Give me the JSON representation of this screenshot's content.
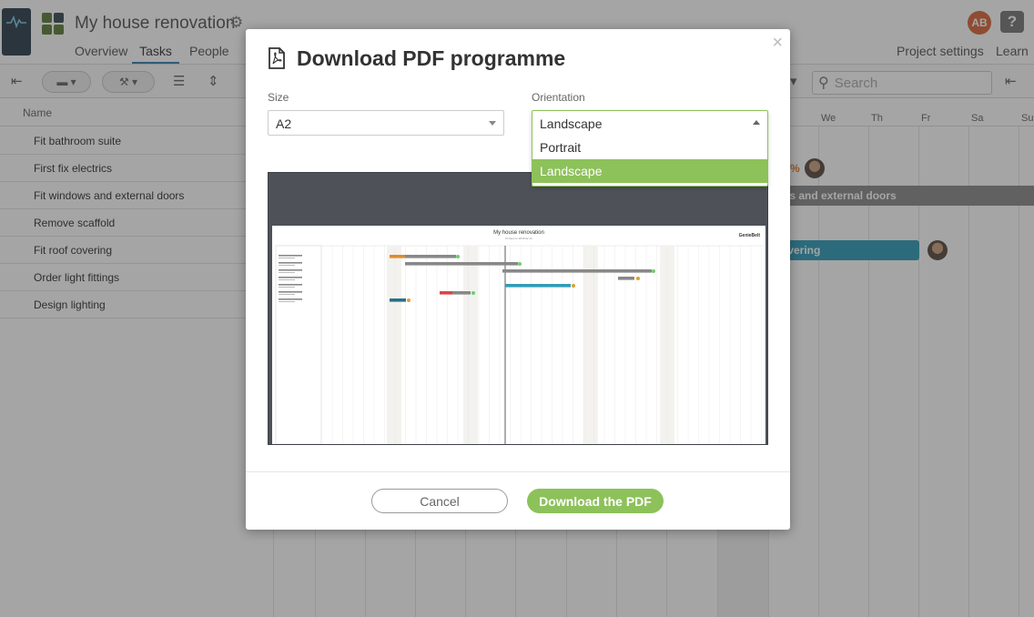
{
  "app": {
    "project_title": "My house renovation",
    "tabs": [
      {
        "label": "Overview"
      },
      {
        "label": "Tasks"
      },
      {
        "label": "People"
      }
    ],
    "project_settings": "Project settings",
    "learn": "Learn",
    "user_initials": "AB",
    "help_glyph": "?",
    "search_placeholder": "Search",
    "name_column": "Name",
    "days": [
      "We",
      "Th",
      "Fr",
      "Sa",
      "Su"
    ],
    "tasks": [
      "Fit bathroom suite",
      "First fix electrics",
      "Fit windows and external doors",
      "Remove scaffold",
      "Fit roof covering",
      "Order light fittings",
      "Design lighting"
    ],
    "bar_windows": "ws and external doors",
    "bar_roof": "overing"
  },
  "modal": {
    "title": "Download PDF programme",
    "close_glyph": "×",
    "size": {
      "label": "Size",
      "value": "A2"
    },
    "orientation": {
      "label": "Orientation",
      "value": "Landscape",
      "options": [
        {
          "label": "Portrait",
          "selected": false
        },
        {
          "label": "Landscape",
          "selected": true
        }
      ]
    },
    "preview": {
      "title": "My house renovation",
      "subtitle": "Printed on 2018 02 12",
      "brand": "GenieBelt"
    },
    "cancel_label": "Cancel",
    "download_label": "Download the PDF"
  },
  "colors": {
    "accent": "#8dc15a",
    "teal": "#2f9cb8",
    "orange": "#e07a2a",
    "dark_gray": "#4e5258"
  },
  "icons": [
    "pulse-logo-icon",
    "apps-grid-icon",
    "gear-icon",
    "pdf-file-icon",
    "search-icon",
    "help-icon",
    "close-icon"
  ]
}
